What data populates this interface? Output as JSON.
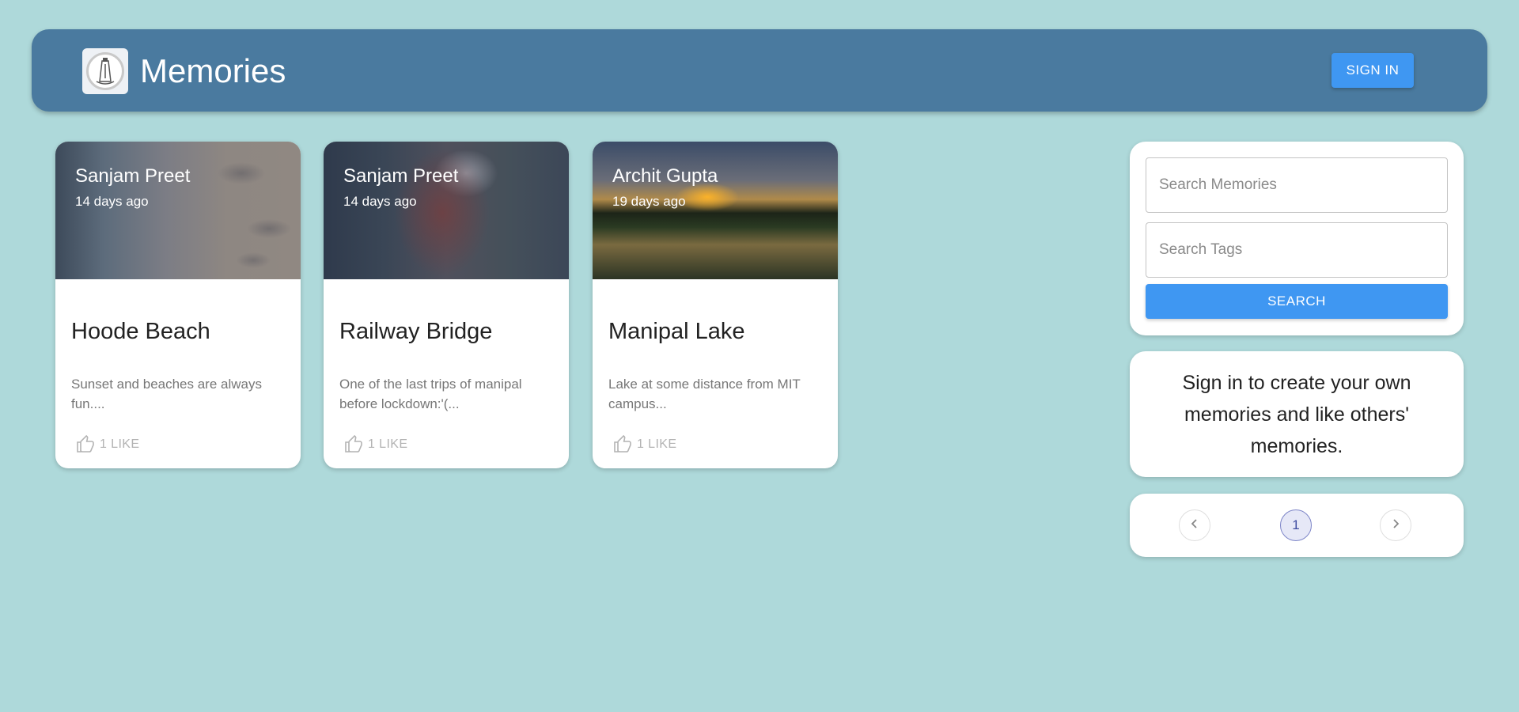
{
  "header": {
    "title": "Memories",
    "sign_in_label": "SIGN IN"
  },
  "posts": [
    {
      "author": "Sanjam Preet",
      "time": "14 days ago",
      "title": "Hoode Beach",
      "description": "Sunset and beaches are always fun....",
      "like_label": "1 LIKE"
    },
    {
      "author": "Sanjam Preet",
      "time": "14 days ago",
      "title": "Railway Bridge",
      "description": "One of the last trips of manipal before lockdown:'(...",
      "like_label": "1 LIKE"
    },
    {
      "author": "Archit Gupta",
      "time": "19 days ago",
      "title": "Manipal Lake",
      "description": "Lake at some distance from MIT campus...",
      "like_label": "1 LIKE"
    }
  ],
  "search": {
    "memories_placeholder": "Search Memories",
    "tags_placeholder": "Search Tags",
    "button_label": "SEARCH"
  },
  "info": {
    "message": "Sign in to create your own memories and like others' memories."
  },
  "pagination": {
    "current_page": "1"
  },
  "colors": {
    "background": "#aed9da",
    "appbar": "#4a7a9f",
    "primary": "#3f97f2"
  },
  "icons": {
    "logo": "lighthouse-logo",
    "like": "thumb-up-icon",
    "prev": "chevron-left-icon",
    "next": "chevron-right-icon"
  }
}
